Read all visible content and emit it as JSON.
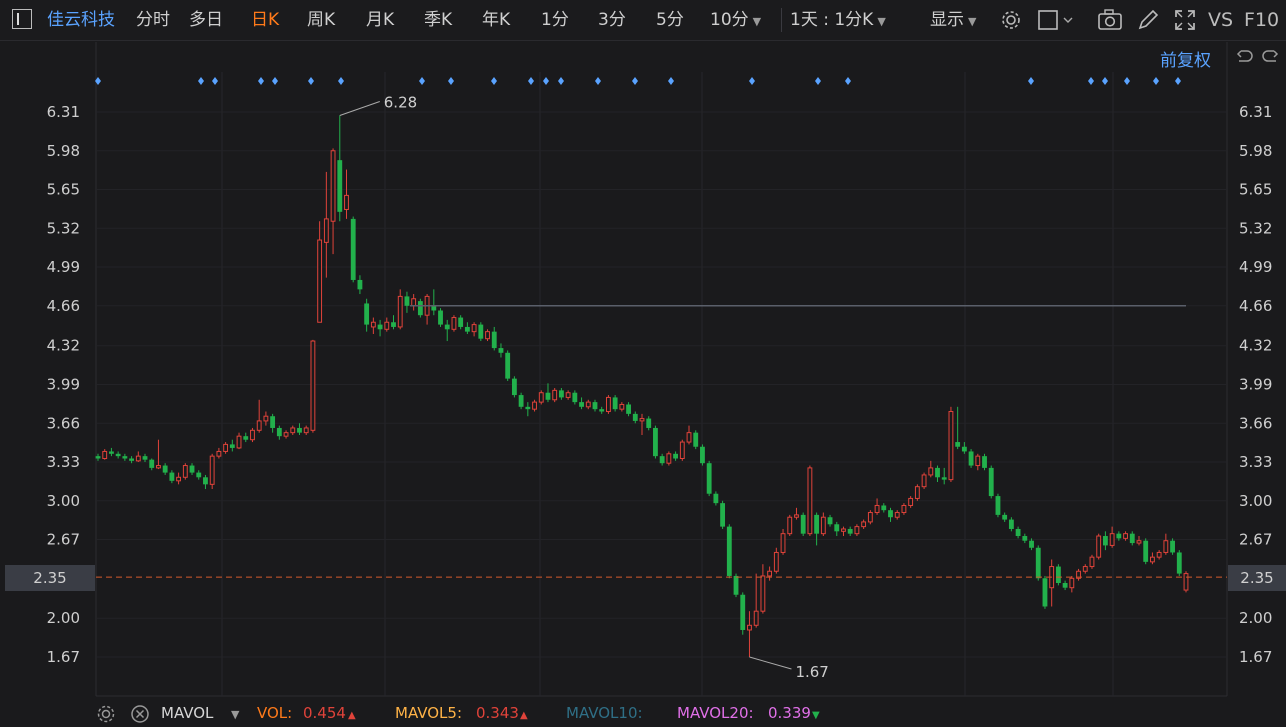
{
  "toolbar": {
    "stock_name": "佳云科技",
    "periods": [
      "分时",
      "多日",
      "日K",
      "周K",
      "月K",
      "季K",
      "年K",
      "1分",
      "3分",
      "5分",
      "10分"
    ],
    "active_period": "日K",
    "interval_select": "1天 : 1分K",
    "display_label": "显示",
    "vs_label": "VS",
    "f10_label": "F10"
  },
  "chart_header": {
    "adjust_label": "前复权"
  },
  "price_axis": {
    "ticks": [
      "6.31",
      "5.98",
      "5.65",
      "5.32",
      "4.99",
      "4.66",
      "4.32",
      "3.99",
      "3.66",
      "3.33",
      "3.00",
      "2.67",
      "2.35",
      "2.00",
      "1.67"
    ],
    "ylim": [
      1.55,
      6.4
    ],
    "last_price": "2.35"
  },
  "annotations": {
    "high_label": "6.28",
    "low_label": "1.67"
  },
  "horizontal_line_price": 4.66,
  "indicators": {
    "name": "MAVOL",
    "vol_label": "VOL:",
    "vol_value": "0.454",
    "mavol5_label": "MAVOL5:",
    "mavol5_value": "0.343",
    "mavol10_label": "MAVOL10:",
    "mavol20_label": "MAVOL20:",
    "mavol20_value": "0.339"
  },
  "colors": {
    "up": "#e0433a",
    "down": "#22b14c",
    "accent": "#ff7a1a",
    "link": "#5aa3ff"
  },
  "chart_data": {
    "type": "candlestick",
    "ylim": [
      1.55,
      6.4
    ],
    "high": 6.28,
    "low": 1.67,
    "last": 2.35,
    "candles": [
      [
        3.38,
        3.36,
        3.4,
        3.34
      ],
      [
        3.36,
        3.42,
        3.44,
        3.35
      ],
      [
        3.42,
        3.4,
        3.45,
        3.38
      ],
      [
        3.4,
        3.38,
        3.42,
        3.36
      ],
      [
        3.38,
        3.36,
        3.4,
        3.34
      ],
      [
        3.36,
        3.34,
        3.38,
        3.32
      ],
      [
        3.34,
        3.38,
        3.42,
        3.33
      ],
      [
        3.38,
        3.35,
        3.4,
        3.33
      ],
      [
        3.35,
        3.28,
        3.36,
        3.26
      ],
      [
        3.28,
        3.3,
        3.52,
        3.27
      ],
      [
        3.3,
        3.24,
        3.32,
        3.22
      ],
      [
        3.24,
        3.17,
        3.26,
        3.15
      ],
      [
        3.17,
        3.2,
        3.24,
        3.14
      ],
      [
        3.2,
        3.3,
        3.32,
        3.18
      ],
      [
        3.3,
        3.24,
        3.32,
        3.22
      ],
      [
        3.24,
        3.2,
        3.26,
        3.18
      ],
      [
        3.2,
        3.14,
        3.22,
        3.1
      ],
      [
        3.14,
        3.38,
        3.4,
        3.1
      ],
      [
        3.38,
        3.42,
        3.45,
        3.36
      ],
      [
        3.42,
        3.48,
        3.5,
        3.4
      ],
      [
        3.48,
        3.45,
        3.52,
        3.42
      ],
      [
        3.45,
        3.55,
        3.58,
        3.44
      ],
      [
        3.55,
        3.52,
        3.58,
        3.5
      ],
      [
        3.52,
        3.6,
        3.62,
        3.5
      ],
      [
        3.6,
        3.68,
        3.86,
        3.58
      ],
      [
        3.68,
        3.72,
        3.76,
        3.64
      ],
      [
        3.72,
        3.62,
        3.74,
        3.58
      ],
      [
        3.62,
        3.55,
        3.64,
        3.52
      ],
      [
        3.55,
        3.58,
        3.6,
        3.53
      ],
      [
        3.58,
        3.62,
        3.64,
        3.56
      ],
      [
        3.62,
        3.58,
        3.66,
        3.56
      ],
      [
        3.58,
        3.62,
        3.64,
        3.56
      ],
      [
        3.6,
        4.36,
        4.37,
        3.58
      ],
      [
        4.52,
        5.22,
        5.38,
        4.8
      ],
      [
        5.2,
        5.4,
        5.8,
        4.9
      ],
      [
        5.38,
        5.98,
        6.0,
        5.1
      ],
      [
        5.9,
        5.46,
        6.28,
        5.38
      ],
      [
        5.48,
        5.6,
        5.82,
        5.4
      ],
      [
        5.4,
        4.88,
        5.42,
        4.86
      ],
      [
        4.88,
        4.8,
        4.92,
        4.76
      ],
      [
        4.68,
        4.5,
        4.72,
        4.44
      ],
      [
        4.48,
        4.52,
        4.56,
        4.42
      ],
      [
        4.5,
        4.46,
        4.54,
        4.4
      ],
      [
        4.46,
        4.52,
        4.56,
        4.44
      ],
      [
        4.52,
        4.48,
        4.58,
        4.46
      ],
      [
        4.48,
        4.74,
        4.8,
        4.46
      ],
      [
        4.74,
        4.66,
        4.78,
        4.6
      ],
      [
        4.66,
        4.72,
        4.76,
        4.62
      ],
      [
        4.7,
        4.58,
        4.72,
        4.56
      ],
      [
        4.58,
        4.74,
        4.76,
        4.5
      ],
      [
        4.66,
        4.62,
        4.8,
        4.58
      ],
      [
        4.62,
        4.5,
        4.64,
        4.48
      ],
      [
        4.5,
        4.46,
        4.54,
        4.36
      ],
      [
        4.46,
        4.56,
        4.58,
        4.44
      ],
      [
        4.56,
        4.48,
        4.58,
        4.46
      ],
      [
        4.48,
        4.44,
        4.52,
        4.42
      ],
      [
        4.44,
        4.5,
        4.52,
        4.4
      ],
      [
        4.5,
        4.38,
        4.52,
        4.36
      ],
      [
        4.38,
        4.44,
        4.46,
        4.36
      ],
      [
        4.44,
        4.3,
        4.48,
        4.28
      ],
      [
        4.3,
        4.26,
        4.34,
        4.22
      ],
      [
        4.26,
        4.04,
        4.28,
        4.02
      ],
      [
        4.04,
        3.9,
        4.06,
        3.88
      ],
      [
        3.9,
        3.8,
        3.92,
        3.78
      ],
      [
        3.8,
        3.78,
        3.84,
        3.72
      ],
      [
        3.78,
        3.84,
        3.86,
        3.76
      ],
      [
        3.84,
        3.92,
        3.94,
        3.82
      ],
      [
        3.92,
        3.86,
        4.0,
        3.84
      ],
      [
        3.86,
        3.94,
        3.96,
        3.84
      ],
      [
        3.94,
        3.88,
        3.96,
        3.86
      ],
      [
        3.88,
        3.92,
        3.94,
        3.86
      ],
      [
        3.92,
        3.84,
        3.94,
        3.82
      ],
      [
        3.84,
        3.8,
        3.88,
        3.78
      ],
      [
        3.8,
        3.84,
        3.86,
        3.78
      ],
      [
        3.84,
        3.78,
        3.86,
        3.76
      ],
      [
        3.78,
        3.76,
        3.8,
        3.74
      ],
      [
        3.76,
        3.88,
        3.9,
        3.74
      ],
      [
        3.88,
        3.78,
        3.9,
        3.76
      ],
      [
        3.78,
        3.82,
        3.84,
        3.76
      ],
      [
        3.82,
        3.74,
        3.84,
        3.72
      ],
      [
        3.74,
        3.68,
        3.76,
        3.66
      ],
      [
        3.68,
        3.7,
        3.74,
        3.56
      ],
      [
        3.7,
        3.62,
        3.72,
        3.6
      ],
      [
        3.62,
        3.38,
        3.64,
        3.36
      ],
      [
        3.38,
        3.32,
        3.4,
        3.3
      ],
      [
        3.32,
        3.4,
        3.42,
        3.3
      ],
      [
        3.4,
        3.36,
        3.42,
        3.34
      ],
      [
        3.36,
        3.5,
        3.52,
        3.34
      ],
      [
        3.5,
        3.58,
        3.64,
        3.48
      ],
      [
        3.58,
        3.46,
        3.6,
        3.44
      ],
      [
        3.46,
        3.32,
        3.48,
        3.3
      ],
      [
        3.32,
        3.06,
        3.34,
        3.04
      ],
      [
        3.06,
        2.98,
        3.08,
        2.96
      ],
      [
        2.98,
        2.78,
        3.0,
        2.76
      ],
      [
        2.78,
        2.36,
        2.8,
        2.34
      ],
      [
        2.36,
        2.2,
        2.38,
        2.18
      ],
      [
        2.2,
        1.9,
        2.22,
        1.86
      ],
      [
        1.9,
        1.94,
        2.06,
        1.67
      ],
      [
        1.94,
        2.06,
        2.38,
        1.92
      ],
      [
        2.06,
        2.36,
        2.46,
        2.04
      ],
      [
        2.36,
        2.4,
        2.44,
        2.32
      ],
      [
        2.4,
        2.56,
        2.6,
        2.38
      ],
      [
        2.56,
        2.72,
        2.76,
        2.54
      ],
      [
        2.72,
        2.86,
        2.88,
        2.7
      ],
      [
        2.86,
        2.88,
        2.94,
        2.84
      ],
      [
        2.88,
        2.72,
        2.9,
        2.7
      ],
      [
        2.72,
        3.28,
        3.3,
        2.7
      ],
      [
        2.88,
        2.72,
        2.9,
        2.62
      ],
      [
        2.72,
        2.86,
        2.9,
        2.7
      ],
      [
        2.86,
        2.8,
        2.88,
        2.78
      ],
      [
        2.8,
        2.74,
        2.82,
        2.7
      ],
      [
        2.74,
        2.76,
        2.78,
        2.7
      ],
      [
        2.76,
        2.72,
        2.78,
        2.7
      ],
      [
        2.72,
        2.78,
        2.8,
        2.7
      ],
      [
        2.78,
        2.82,
        2.84,
        2.76
      ],
      [
        2.82,
        2.9,
        2.92,
        2.8
      ],
      [
        2.9,
        2.96,
        3.02,
        2.88
      ],
      [
        2.96,
        2.92,
        2.98,
        2.9
      ],
      [
        2.92,
        2.86,
        2.94,
        2.82
      ],
      [
        2.86,
        2.9,
        2.92,
        2.84
      ],
      [
        2.9,
        2.96,
        2.98,
        2.88
      ],
      [
        2.96,
        3.02,
        3.04,
        2.94
      ],
      [
        3.02,
        3.12,
        3.14,
        3.0
      ],
      [
        3.12,
        3.22,
        3.24,
        3.1
      ],
      [
        3.22,
        3.28,
        3.34,
        3.2
      ],
      [
        3.28,
        3.2,
        3.3,
        3.16
      ],
      [
        3.2,
        3.18,
        3.28,
        3.14
      ],
      [
        3.18,
        3.76,
        3.8,
        3.16
      ],
      [
        3.5,
        3.46,
        3.8,
        3.44
      ],
      [
        3.46,
        3.42,
        3.5,
        3.4
      ],
      [
        3.42,
        3.3,
        3.44,
        3.28
      ],
      [
        3.3,
        3.38,
        3.4,
        3.26
      ],
      [
        3.38,
        3.28,
        3.4,
        3.26
      ],
      [
        3.28,
        3.04,
        3.3,
        3.02
      ],
      [
        3.04,
        2.88,
        3.06,
        2.86
      ],
      [
        2.88,
        2.84,
        2.9,
        2.82
      ],
      [
        2.84,
        2.76,
        2.86,
        2.74
      ],
      [
        2.76,
        2.7,
        2.78,
        2.68
      ],
      [
        2.7,
        2.66,
        2.72,
        2.64
      ],
      [
        2.66,
        2.6,
        2.68,
        2.58
      ],
      [
        2.6,
        2.34,
        2.62,
        2.32
      ],
      [
        2.34,
        2.1,
        2.36,
        2.08
      ],
      [
        2.26,
        2.44,
        2.5,
        2.1
      ],
      [
        2.44,
        2.3,
        2.46,
        2.28
      ],
      [
        2.3,
        2.26,
        2.32,
        2.24
      ],
      [
        2.26,
        2.34,
        2.36,
        2.22
      ],
      [
        2.34,
        2.4,
        2.42,
        2.32
      ],
      [
        2.4,
        2.44,
        2.46,
        2.38
      ],
      [
        2.44,
        2.52,
        2.54,
        2.42
      ],
      [
        2.52,
        2.7,
        2.72,
        2.5
      ],
      [
        2.7,
        2.62,
        2.74,
        2.58
      ],
      [
        2.62,
        2.72,
        2.78,
        2.6
      ],
      [
        2.72,
        2.68,
        2.74,
        2.66
      ],
      [
        2.68,
        2.72,
        2.74,
        2.66
      ],
      [
        2.72,
        2.64,
        2.74,
        2.62
      ],
      [
        2.64,
        2.66,
        2.7,
        2.62
      ],
      [
        2.66,
        2.48,
        2.68,
        2.46
      ],
      [
        2.48,
        2.52,
        2.56,
        2.46
      ],
      [
        2.52,
        2.56,
        2.58,
        2.5
      ],
      [
        2.56,
        2.66,
        2.72,
        2.54
      ],
      [
        2.66,
        2.56,
        2.68,
        2.54
      ],
      [
        2.56,
        2.38,
        2.58,
        2.36
      ],
      [
        2.24,
        2.38,
        2.4,
        2.22
      ]
    ]
  }
}
